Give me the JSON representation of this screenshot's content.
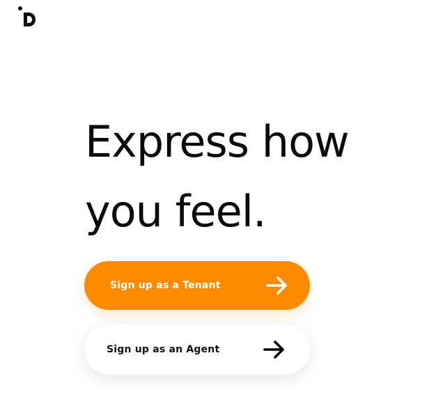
{
  "brand": {
    "logo_letter": "D",
    "accent_color": "#ff8a00"
  },
  "hero": {
    "line1": "Express how",
    "line2": "you feel."
  },
  "actions": {
    "tenant": {
      "label": "Sign up as a Tenant",
      "icon": "arrow-right-icon"
    },
    "agent": {
      "label": "Sign up as an Agent",
      "icon": "arrow-right-icon"
    }
  }
}
